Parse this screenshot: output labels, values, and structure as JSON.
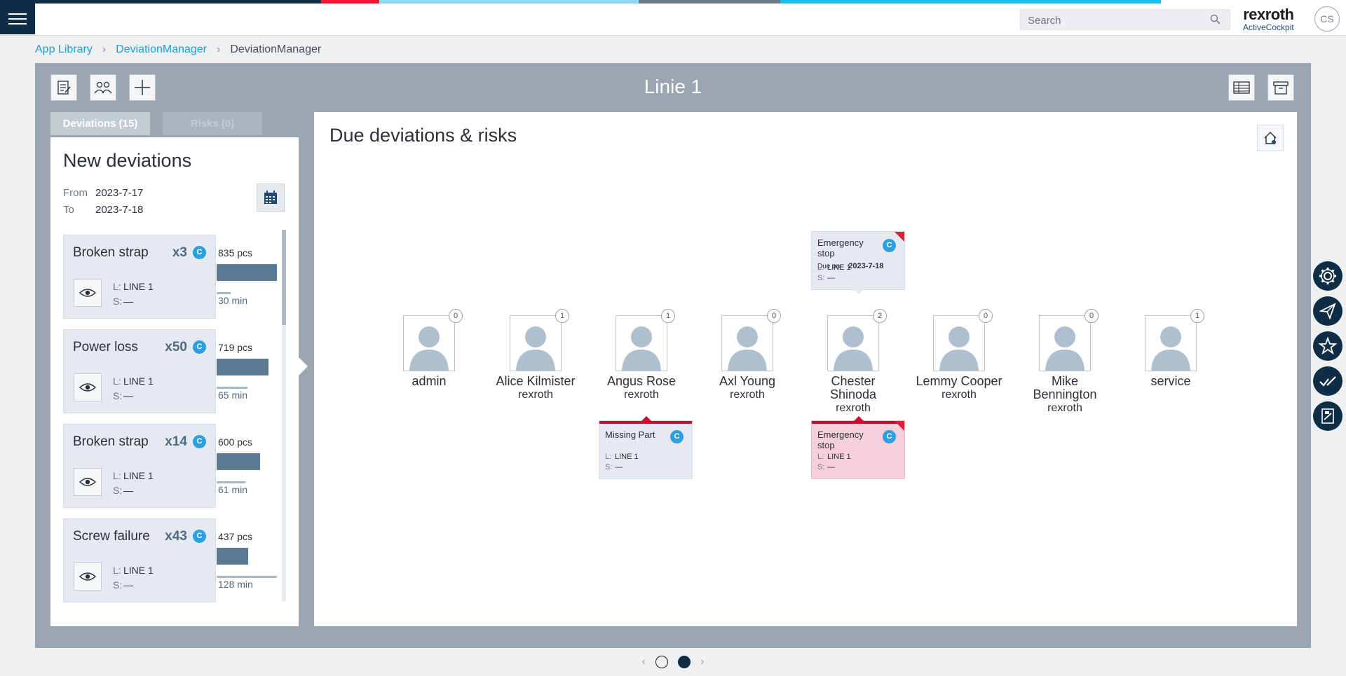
{
  "header": {
    "stripe_colors": [
      "#0f2e45",
      "#0f2e45",
      "#e01e37",
      "#8fd6ef",
      "#6b7a86",
      "#1dbbe6",
      "#ffffff"
    ],
    "search_placeholder": "Search",
    "logo_text": "rexroth",
    "logo_sub": "ActiveCockpit",
    "user_initials": "CS"
  },
  "breadcrumb": {
    "items": [
      "App Library",
      "DeviationManager"
    ],
    "current": "DeviationManager"
  },
  "frame": {
    "title": "Linie 1",
    "tabs": [
      "Deviations (15)",
      "Risks (0)"
    ]
  },
  "left": {
    "heading": "New deviations",
    "from_label": "From",
    "from_value": "2023-7-17",
    "to_label": "To",
    "to_value": "2023-7-18",
    "deviations": [
      {
        "title": "Broken strap",
        "count": "x3",
        "badge": "C",
        "line_label": "L:",
        "line": "LINE 1",
        "station_label": "S:",
        "station": "—",
        "pcs": "835 pcs",
        "pcs_fraction": 1.0,
        "min": "30 min",
        "min_fraction": 0.23
      },
      {
        "title": "Power loss",
        "count": "x50",
        "badge": "C",
        "line_label": "L:",
        "line": "LINE 1",
        "station_label": "S:",
        "station": "—",
        "pcs": "719 pcs",
        "pcs_fraction": 0.86,
        "min": "65 min",
        "min_fraction": 0.51
      },
      {
        "title": "Broken strap",
        "count": "x14",
        "badge": "C",
        "line_label": "L:",
        "line": "LINE 1",
        "station_label": "S:",
        "station": "—",
        "pcs": "600 pcs",
        "pcs_fraction": 0.72,
        "min": "61 min",
        "min_fraction": 0.48
      },
      {
        "title": "Screw failure",
        "count": "x43",
        "badge": "C",
        "line_label": "L:",
        "line": "LINE 1",
        "station_label": "S:",
        "station": "—",
        "pcs": "437 pcs",
        "pcs_fraction": 0.52,
        "min": "128 min",
        "min_fraction": 1.0
      }
    ]
  },
  "main": {
    "heading": "Due deviations & risks",
    "people": [
      {
        "name": "admin",
        "org": "",
        "count": "0"
      },
      {
        "name": "Alice Kilmister",
        "org": "rexroth",
        "count": "1"
      },
      {
        "name": "Angus Rose",
        "org": "rexroth",
        "count": "1"
      },
      {
        "name": "Axl Young",
        "org": "rexroth",
        "count": "0"
      },
      {
        "name": "Chester Shinoda",
        "org": "rexroth",
        "count": "2"
      },
      {
        "name": "Lemmy Cooper",
        "org": "rexroth",
        "count": "0"
      },
      {
        "name": "Mike Bennington",
        "org": "rexroth",
        "count": "0"
      },
      {
        "name": "service",
        "org": "",
        "count": "1"
      }
    ],
    "tiles": [
      {
        "title": "Emergency stop",
        "badge": "C",
        "due_label": "Due on",
        "due": "2023-7-18",
        "line_label": "L:",
        "line": "LINE 1",
        "station_label": "S:",
        "station": "—"
      },
      {
        "title": "Missing Part",
        "badge": "C",
        "line_label": "L:",
        "line": "LINE 1",
        "station_label": "S:",
        "station": "—"
      },
      {
        "title": "Emergency stop",
        "badge": "C",
        "line_label": "L:",
        "line": "LINE 1",
        "station_label": "S:",
        "station": "—"
      }
    ]
  },
  "colors": {
    "accent": "#1aa1d8",
    "navy": "#0f2e45",
    "frame": "#9ba6b2",
    "alert_red": "#c8102e",
    "alert_pink": "#f5d0da",
    "badge_blue": "#2e9fe0",
    "bar": "#5a7a94"
  },
  "pager": {
    "pages": 2,
    "current": 2
  }
}
